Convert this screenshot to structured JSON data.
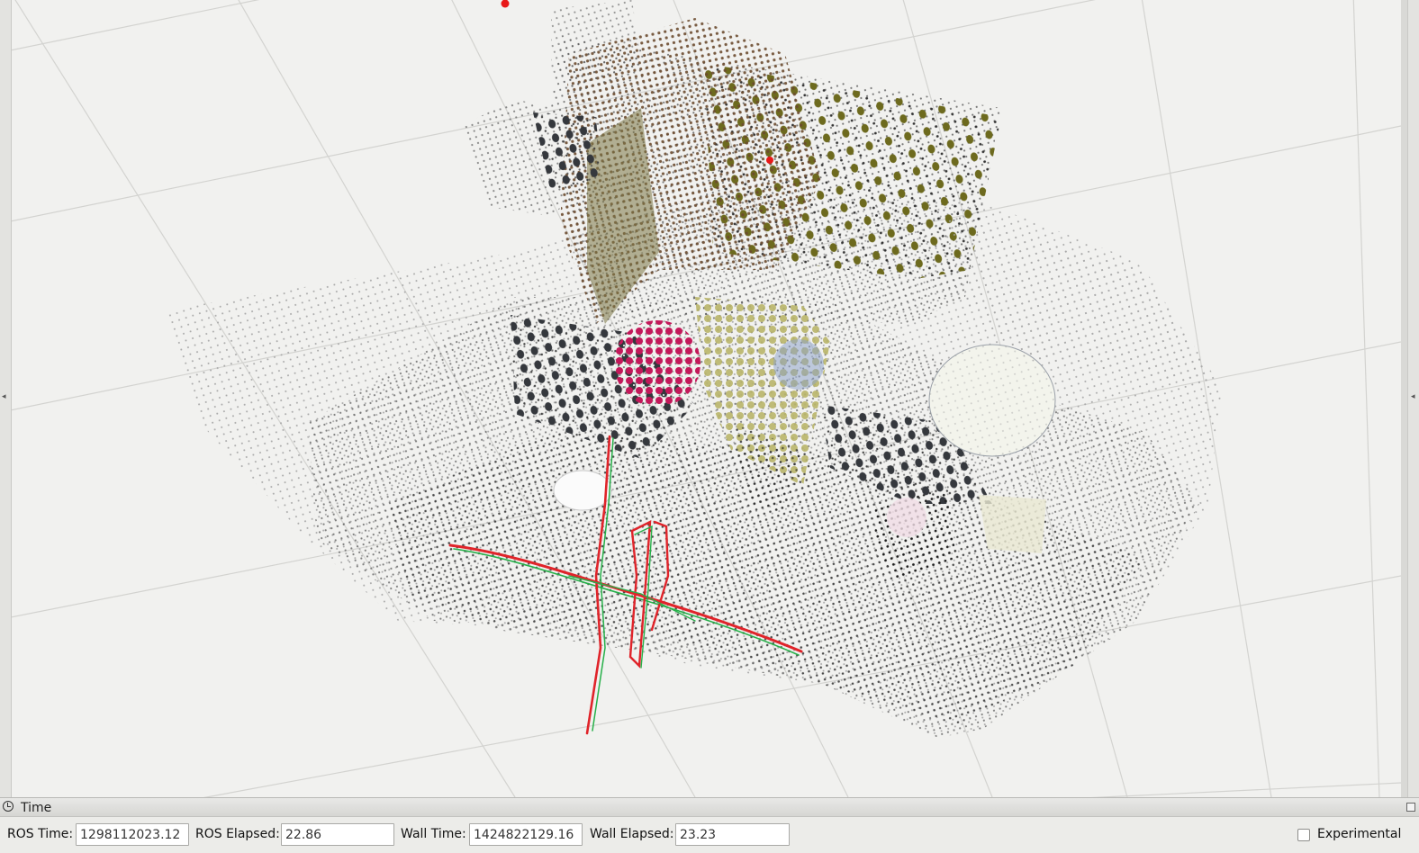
{
  "time_panel": {
    "title": "Time",
    "ros_time": {
      "label": "ROS Time:",
      "value": "1298112023.12"
    },
    "ros_elapsed": {
      "label": "ROS Elapsed:",
      "value": "22.86"
    },
    "wall_time": {
      "label": "Wall Time:",
      "value": "1424822129.16"
    },
    "wall_elapsed": {
      "label": "Wall Elapsed:",
      "value": "23.23"
    },
    "experimental": {
      "label": "Experimental",
      "checked": false
    }
  },
  "icons": {
    "time_panel": "clock-icon",
    "undock": "undock-icon",
    "left_collapse": "collapse-left-arrow-icon",
    "right_collapse": "collapse-right-arrow-icon"
  },
  "colors": {
    "background": "#f1f1ef",
    "grid": "#cfcfcc",
    "trajectory_red": "#e0242a",
    "trajectory_green": "#27b04a",
    "point_marker": "#e81818"
  }
}
